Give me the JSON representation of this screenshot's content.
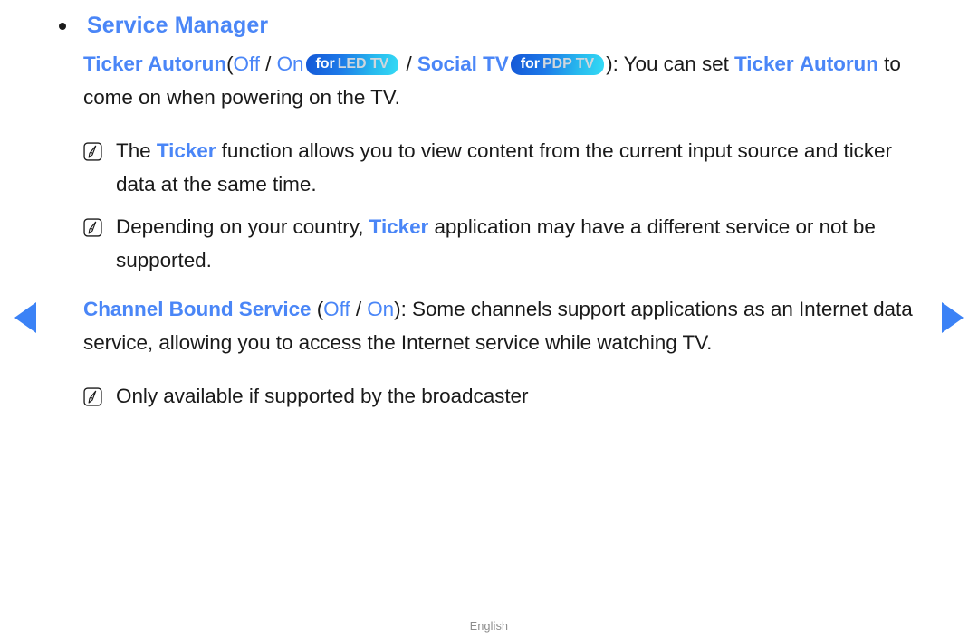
{
  "nav": {
    "prev_label": "previous page",
    "next_label": "next page"
  },
  "section": {
    "title": "Service Manager"
  },
  "items": {
    "ticker_autorun": {
      "name": "Ticker Autorun",
      "paren_open": "(",
      "option_off": "Off",
      "separator1": " / ",
      "option_on": "On",
      "badge_led": {
        "for": "for",
        "model": "LED TV"
      },
      "separator2": " / ",
      "social_tv": "Social TV",
      "badge_pdp": {
        "for": "for",
        "model": "PDP TV"
      },
      "paren_close": ")",
      "description_a": ": You can set ",
      "emphasis1": "Ticker",
      "emphasis2": "Autorun",
      "description_b": " to come on when powering on the TV."
    },
    "channel_bound": {
      "name": "Channel Bound Service",
      "paren_open": "(",
      "option_off": "Off",
      "separator1": " / ",
      "option_on": "On",
      "paren_close": ")",
      "description": ": Some channels support applications as an Internet data service, allowing you to access the Internet service while watching TV."
    }
  },
  "notes": [
    {
      "icon": "note-pencil-icon",
      "text_a": "The ",
      "highlight": "Ticker",
      "text_b": " function allows you to view content from the current input source and ticker data at the same time."
    },
    {
      "icon": "note-pencil-icon",
      "text_a": "Depending on your country, ",
      "highlight": "Ticker",
      "text_b": " application may have a different service or not be supported."
    },
    {
      "icon": "note-pencil-icon",
      "text_a": "Only available if supported by the broadcaster",
      "highlight": "",
      "text_b": ""
    }
  ],
  "footer": {
    "language": "English"
  },
  "colors": {
    "accent_blue": "#4a86f7",
    "arrow_blue": "#3b82f6",
    "body_text": "#1a1a1a",
    "footer_text": "#8c8c8c",
    "badge_gradient_start": "#1457d6",
    "badge_gradient_end": "#35dbf5"
  }
}
